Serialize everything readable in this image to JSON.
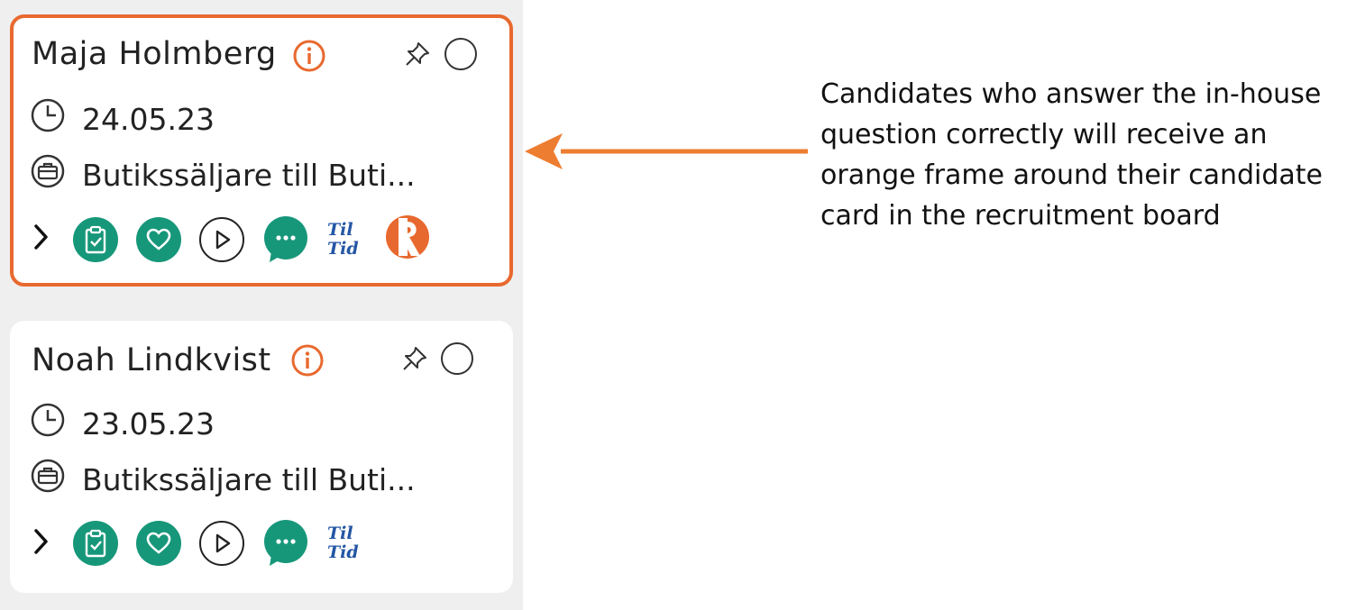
{
  "candidates": [
    {
      "name": "Maja Holmberg",
      "date": "24.05.23",
      "job": "Butikssäljare till Buti...",
      "highlighted": true,
      "tiltid_line1": "Til",
      "tiltid_line2": "Tid",
      "icons": [
        "chevron-right-icon",
        "clipboard-check-icon",
        "heart-icon",
        "play-icon",
        "chat-bubble-icon",
        "tiltid-logo",
        "r-logo"
      ]
    },
    {
      "name": "Noah Lindkvist",
      "date": "23.05.23",
      "job": "Butikssäljare till Buti...",
      "highlighted": false,
      "tiltid_line1": "Til",
      "tiltid_line2": "Tid",
      "icons": [
        "chevron-right-icon",
        "clipboard-check-icon",
        "heart-icon",
        "play-icon",
        "chat-bubble-icon",
        "tiltid-logo"
      ]
    }
  ],
  "annotation": {
    "text": "Candidates who answer the in-house question correctly will receive an orange frame around their candidate card in the recruitment board"
  },
  "colors": {
    "highlight_border": "#e8692f",
    "green_icon": "#17977a",
    "tiltid_blue": "#2356a4",
    "arrow": "#ed7d31",
    "board_background": "#efefef"
  }
}
